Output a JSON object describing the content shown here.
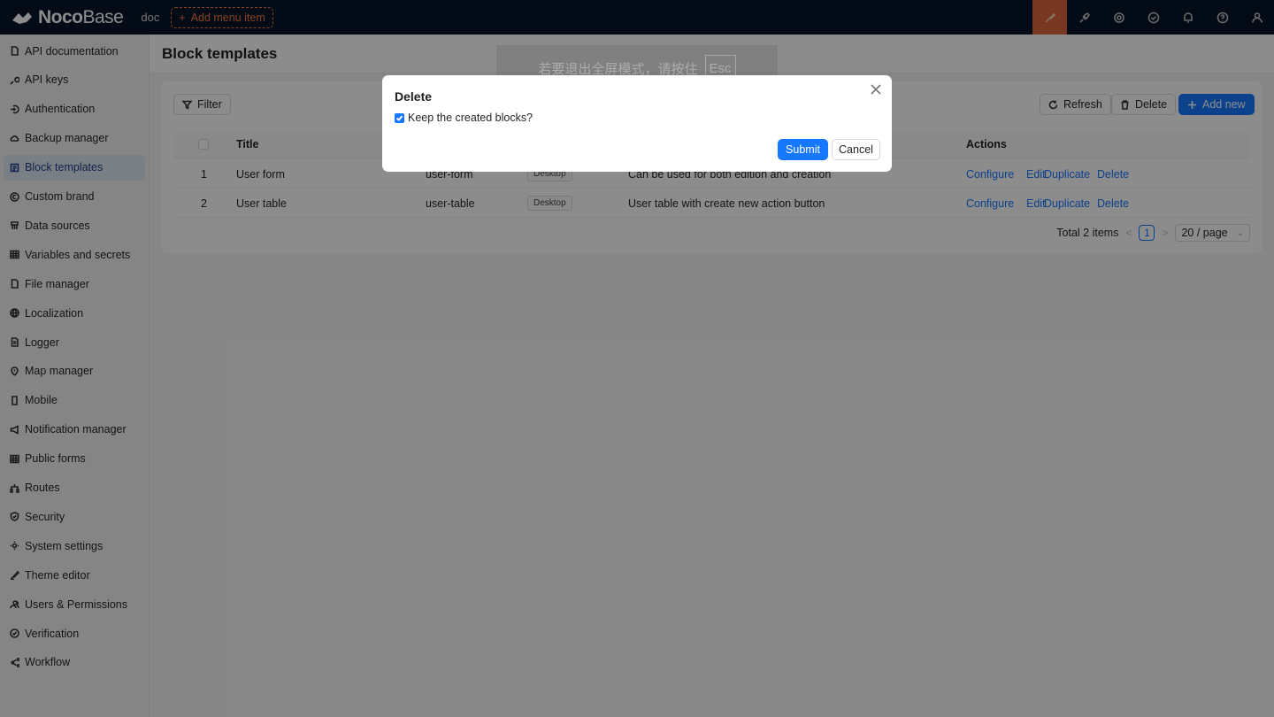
{
  "topbar": {
    "logo_bold": "Noco",
    "logo_light": "Base",
    "app_name": "doc",
    "add_menu_item": "Add menu item",
    "icons": [
      "paintbrush-icon",
      "plugin-icon",
      "gear-icon",
      "check-circle-icon",
      "bell-icon",
      "help-icon",
      "user-icon"
    ]
  },
  "sidebar": {
    "items": [
      {
        "label": "API documentation",
        "icon": "file-icon"
      },
      {
        "label": "API keys",
        "icon": "key-icon"
      },
      {
        "label": "Authentication",
        "icon": "login-icon"
      },
      {
        "label": "Backup manager",
        "icon": "cloud-icon"
      },
      {
        "label": "Block templates",
        "icon": "layout-icon",
        "active": true
      },
      {
        "label": "Custom brand",
        "icon": "copyright-icon"
      },
      {
        "label": "Data sources",
        "icon": "database-icon"
      },
      {
        "label": "Variables and secrets",
        "icon": "table-icon"
      },
      {
        "label": "File manager",
        "icon": "file-icon"
      },
      {
        "label": "Localization",
        "icon": "globe-icon"
      },
      {
        "label": "Logger",
        "icon": "document-icon"
      },
      {
        "label": "Map manager",
        "icon": "pin-icon"
      },
      {
        "label": "Mobile",
        "icon": "mobile-icon"
      },
      {
        "label": "Notification manager",
        "icon": "sound-icon"
      },
      {
        "label": "Public forms",
        "icon": "table-icon"
      },
      {
        "label": "Routes",
        "icon": "tree-icon"
      },
      {
        "label": "Security",
        "icon": "shield-icon"
      },
      {
        "label": "System settings",
        "icon": "gear-icon"
      },
      {
        "label": "Theme editor",
        "icon": "paintbrush-icon"
      },
      {
        "label": "Users & Permissions",
        "icon": "users-icon"
      },
      {
        "label": "Verification",
        "icon": "check-circle-icon"
      },
      {
        "label": "Workflow",
        "icon": "workflow-icon"
      }
    ]
  },
  "main": {
    "title": "Block templates",
    "filter": "Filter",
    "refresh": "Refresh",
    "delete": "Delete",
    "add_new": "Add new",
    "columns": {
      "title": "Title",
      "actions": "Actions"
    },
    "rows": [
      {
        "index": "1",
        "title": "User form",
        "key": "user-form",
        "type": "Desktop",
        "description": "Can be used for both edition and creation",
        "actions": [
          "Configure",
          "Edit",
          "Duplicate",
          "Delete"
        ]
      },
      {
        "index": "2",
        "title": "User table",
        "key": "user-table",
        "type": "Desktop",
        "description": "User table with create new action button",
        "actions": [
          "Configure",
          "Edit",
          "Duplicate",
          "Delete"
        ]
      }
    ],
    "pagination": {
      "total": "Total 2 items",
      "current": "1",
      "page_size": "20 / page"
    }
  },
  "toast": {
    "text": "若要退出全屏模式，请按住",
    "key": "Esc"
  },
  "modal": {
    "title": "Delete",
    "checkbox_label": "Keep the created blocks?",
    "checked": true,
    "submit": "Submit",
    "cancel": "Cancel"
  },
  "colors": {
    "primary": "#1677ff",
    "topbar": "#051529",
    "active_tab": "#d9653b"
  }
}
